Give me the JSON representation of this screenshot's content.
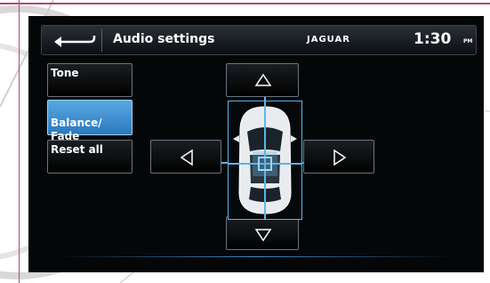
{
  "header": {
    "title": "Audio settings",
    "brand": "JAGUAR",
    "time": "1:30",
    "ampm": "PM",
    "back_icon": "back-arrow-icon"
  },
  "menu": {
    "items": [
      {
        "label": "Tone",
        "active": false
      },
      {
        "label": "Balance/\nFade",
        "active": true
      },
      {
        "label": "Reset all",
        "active": false
      }
    ]
  },
  "controls": {
    "up_icon": "triangle-up-icon",
    "down_icon": "triangle-down-icon",
    "left_icon": "triangle-left-icon",
    "right_icon": "triangle-right-icon"
  },
  "colors": {
    "accent": "#3d8fd4",
    "active_button": "#4a9ad8",
    "crosshair": "#5fb4e6"
  }
}
